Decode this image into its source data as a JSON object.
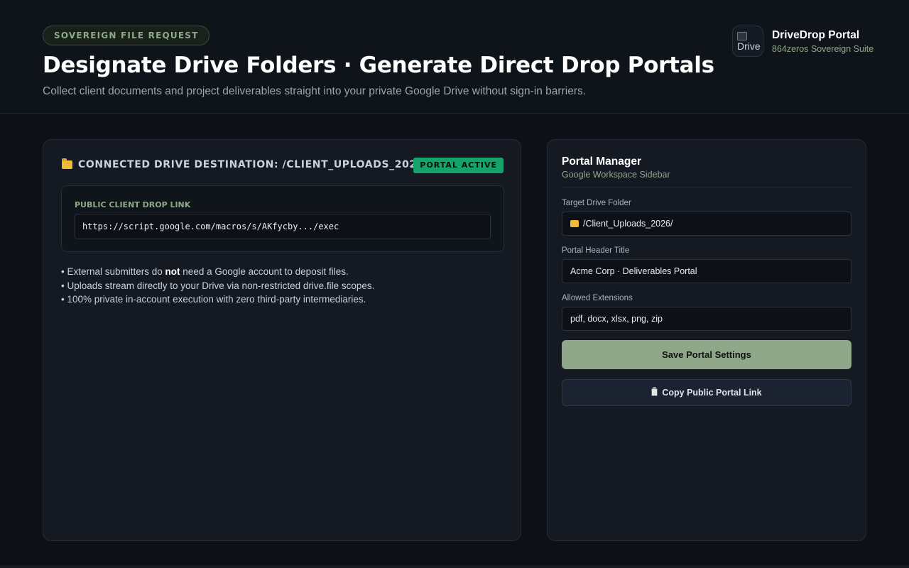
{
  "header": {
    "eyebrow": "SOVEREIGN FILE REQUEST",
    "title": "Designate Drive Folders · Generate Direct Drop Portals",
    "subtitle": "Collect client documents and project deliverables straight into your private Google Drive without sign-in barriers.",
    "brand": {
      "logo_alt": "Drive",
      "name": "DriveDrop Portal",
      "suite": "864zeros Sovereign Suite"
    }
  },
  "left_panel": {
    "destination_label": "CONNECTED DRIVE DESTINATION: /CLIENT_UPLOADS_2026/",
    "status_badge": "PORTAL ACTIVE",
    "link_label": "PUBLIC CLIENT DROP LINK",
    "link_value": "https://script.google.com/macros/s/AKfycby.../exec",
    "bullets": {
      "b1_pre": "• External submitters do ",
      "b1_bold": "not",
      "b1_post": " need a Google account to deposit files.",
      "b2": "• Uploads stream directly to your Drive via non-restricted drive.file scopes.",
      "b3": "• 100% private in-account execution with zero third-party intermediaries."
    }
  },
  "portal_manager": {
    "title": "Portal Manager",
    "subtitle": "Google Workspace Sidebar",
    "fields": {
      "folder_label": "Target Drive Folder",
      "folder_value": "/Client_Uploads_2026/",
      "header_label": "Portal Header Title",
      "header_value": "Acme Corp · Deliverables Portal",
      "ext_label": "Allowed Extensions",
      "ext_value": "pdf, docx, xlsx, png, zip"
    },
    "save_label": "Save Portal Settings",
    "copy_label": "Copy Public Portal Link"
  },
  "colors": {
    "accent_sage": "#8fa88a",
    "status_green": "#16a36b",
    "background": "#0d1117",
    "panel": "#141922"
  },
  "icons": [
    "folder-icon",
    "clipboard-icon",
    "image-placeholder-icon"
  ]
}
